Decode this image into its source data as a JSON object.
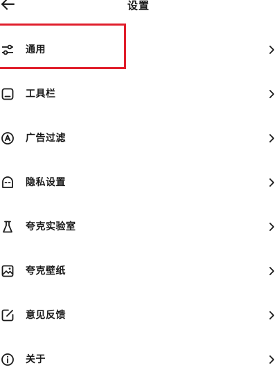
{
  "header": {
    "title": "设置",
    "back_icon": "arrow-left-icon"
  },
  "menu": {
    "items": [
      {
        "label": "通用",
        "icon": "sliders-icon"
      },
      {
        "label": "工具栏",
        "icon": "toolbar-icon"
      },
      {
        "label": "广告过滤",
        "icon": "ad-block-icon"
      },
      {
        "label": "隐私设置",
        "icon": "privacy-mask-icon"
      },
      {
        "label": "夸克实验室",
        "icon": "flask-icon"
      },
      {
        "label": "夸克壁纸",
        "icon": "wallpaper-image-icon"
      },
      {
        "label": "意见反馈",
        "icon": "feedback-edit-icon"
      },
      {
        "label": "关于",
        "icon": "info-icon"
      }
    ]
  },
  "highlight": {
    "target": "通用",
    "color": "#e01e2b"
  }
}
